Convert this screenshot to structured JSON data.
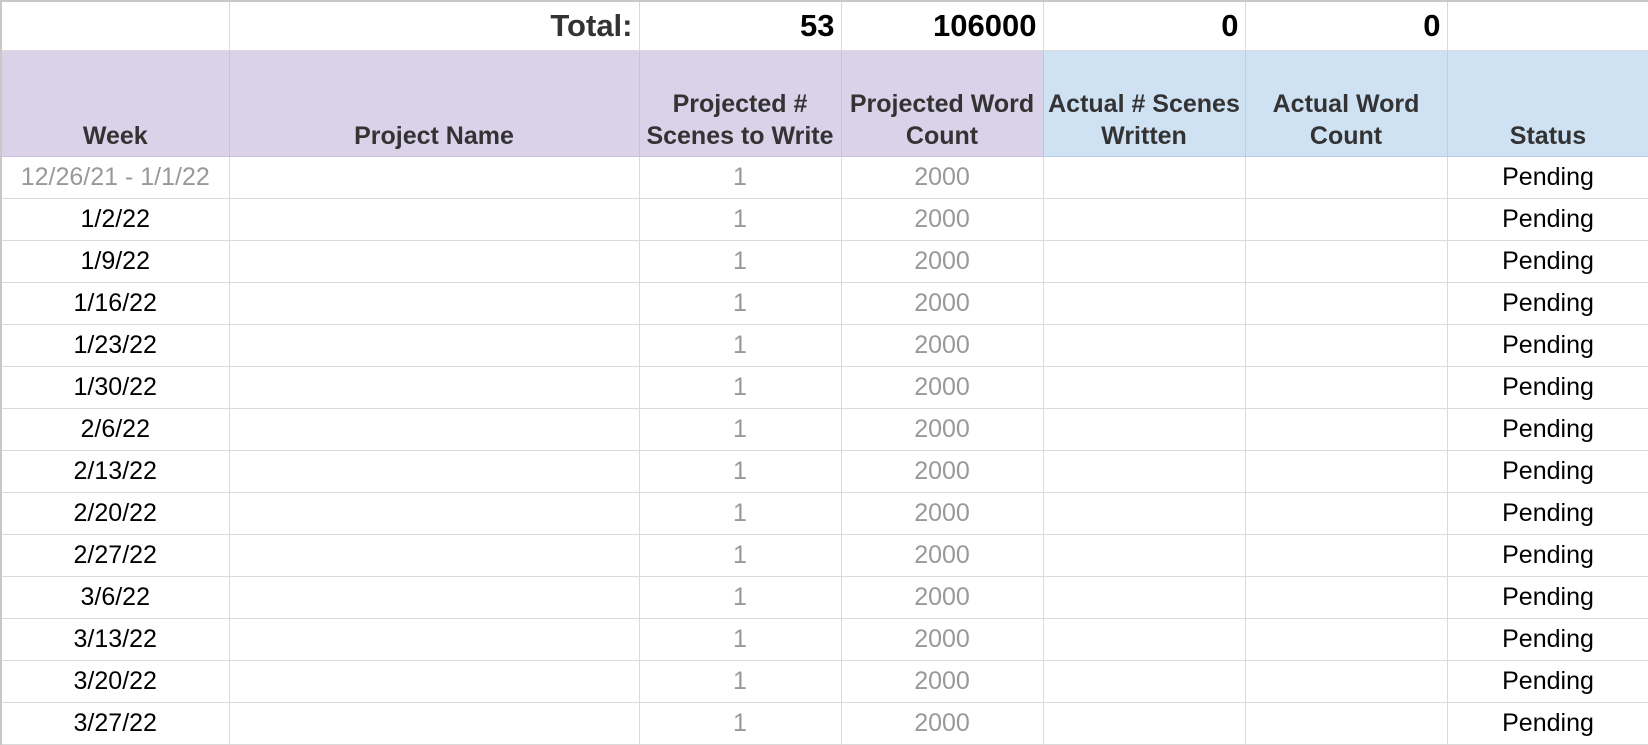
{
  "totals": {
    "label": "Total:",
    "projected_scenes": "53",
    "projected_words": "106000",
    "actual_scenes": "0",
    "actual_words": "0"
  },
  "headers": {
    "week": "Week",
    "project_name": "Project Name",
    "projected_scenes": "Projected # Scenes to Write",
    "projected_words": "Projected Word Count",
    "actual_scenes": "Actual # Scenes Written",
    "actual_words": "Actual Word Count",
    "status": "Status"
  },
  "colors": {
    "projected_header_bg": "#d9d2e9",
    "actual_header_bg": "#cfe2f3",
    "muted_text": "#999999"
  },
  "rows": [
    {
      "week": "12/26/21 - 1/1/22",
      "project_name": "",
      "projected_scenes": "1",
      "projected_words": "2000",
      "actual_scenes": "",
      "actual_words": "",
      "status": "Pending"
    },
    {
      "week": "1/2/22",
      "project_name": "",
      "projected_scenes": "1",
      "projected_words": "2000",
      "actual_scenes": "",
      "actual_words": "",
      "status": "Pending"
    },
    {
      "week": "1/9/22",
      "project_name": "",
      "projected_scenes": "1",
      "projected_words": "2000",
      "actual_scenes": "",
      "actual_words": "",
      "status": "Pending"
    },
    {
      "week": "1/16/22",
      "project_name": "",
      "projected_scenes": "1",
      "projected_words": "2000",
      "actual_scenes": "",
      "actual_words": "",
      "status": "Pending"
    },
    {
      "week": "1/23/22",
      "project_name": "",
      "projected_scenes": "1",
      "projected_words": "2000",
      "actual_scenes": "",
      "actual_words": "",
      "status": "Pending"
    },
    {
      "week": "1/30/22",
      "project_name": "",
      "projected_scenes": "1",
      "projected_words": "2000",
      "actual_scenes": "",
      "actual_words": "",
      "status": "Pending"
    },
    {
      "week": "2/6/22",
      "project_name": "",
      "projected_scenes": "1",
      "projected_words": "2000",
      "actual_scenes": "",
      "actual_words": "",
      "status": "Pending"
    },
    {
      "week": "2/13/22",
      "project_name": "",
      "projected_scenes": "1",
      "projected_words": "2000",
      "actual_scenes": "",
      "actual_words": "",
      "status": "Pending"
    },
    {
      "week": "2/20/22",
      "project_name": "",
      "projected_scenes": "1",
      "projected_words": "2000",
      "actual_scenes": "",
      "actual_words": "",
      "status": "Pending"
    },
    {
      "week": "2/27/22",
      "project_name": "",
      "projected_scenes": "1",
      "projected_words": "2000",
      "actual_scenes": "",
      "actual_words": "",
      "status": "Pending"
    },
    {
      "week": "3/6/22",
      "project_name": "",
      "projected_scenes": "1",
      "projected_words": "2000",
      "actual_scenes": "",
      "actual_words": "",
      "status": "Pending"
    },
    {
      "week": "3/13/22",
      "project_name": "",
      "projected_scenes": "1",
      "projected_words": "2000",
      "actual_scenes": "",
      "actual_words": "",
      "status": "Pending"
    },
    {
      "week": "3/20/22",
      "project_name": "",
      "projected_scenes": "1",
      "projected_words": "2000",
      "actual_scenes": "",
      "actual_words": "",
      "status": "Pending"
    },
    {
      "week": "3/27/22",
      "project_name": "",
      "projected_scenes": "1",
      "projected_words": "2000",
      "actual_scenes": "",
      "actual_words": "",
      "status": "Pending"
    }
  ]
}
